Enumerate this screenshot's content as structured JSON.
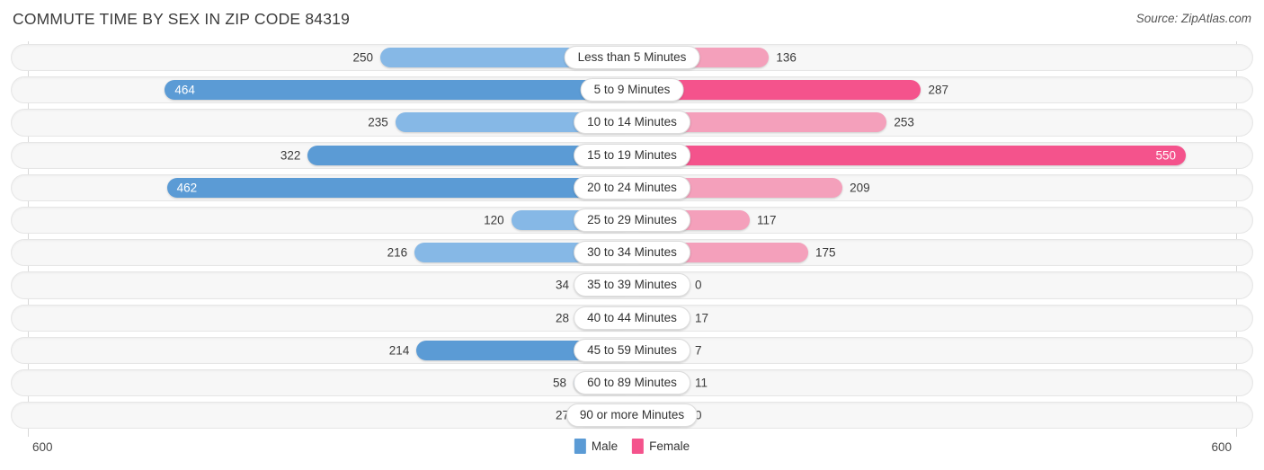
{
  "header": {
    "title": "COMMUTE TIME BY SEX IN ZIP CODE 84319",
    "source": "Source: ZipAtlas.com"
  },
  "legend": {
    "male_label": "Male",
    "female_label": "Female",
    "male_color": "#5b9bd5",
    "female_color": "#f4538c"
  },
  "axis": {
    "left_max": "600",
    "right_max": "600"
  },
  "colors": {
    "male_light": "#86b8e6",
    "male_dark": "#5b9bd5",
    "female_light": "#f4a0bb",
    "female_dark": "#f4538c",
    "track": "#f7f7f7",
    "text": "#3a3a3a"
  },
  "chart_data": {
    "type": "bar",
    "title": "COMMUTE TIME BY SEX IN ZIP CODE 84319",
    "orientation": "horizontal-diverging",
    "xlabel": "",
    "ylabel": "",
    "axis_max": 600,
    "xlim": [
      600,
      600
    ],
    "grid": false,
    "legend_position": "bottom-center",
    "categories": [
      "Less than 5 Minutes",
      "5 to 9 Minutes",
      "10 to 14 Minutes",
      "15 to 19 Minutes",
      "20 to 24 Minutes",
      "25 to 29 Minutes",
      "30 to 34 Minutes",
      "35 to 39 Minutes",
      "40 to 44 Minutes",
      "45 to 59 Minutes",
      "60 to 89 Minutes",
      "90 or more Minutes"
    ],
    "series": [
      {
        "name": "Male",
        "color": "#5b9bd5",
        "values": [
          250,
          464,
          235,
          322,
          462,
          120,
          216,
          34,
          28,
          214,
          58,
          27
        ]
      },
      {
        "name": "Female",
        "color": "#f4538c",
        "values": [
          136,
          287,
          253,
          550,
          209,
          117,
          175,
          0,
          17,
          7,
          11,
          0
        ]
      }
    ]
  },
  "rows": [
    {
      "category": "Less than 5 Minutes",
      "male": 250,
      "male_text": "250",
      "male_inside": false,
      "male_shade": "light",
      "female": 136,
      "female_text": "136",
      "female_inside": false,
      "female_shade": "light"
    },
    {
      "category": "5 to 9 Minutes",
      "male": 464,
      "male_text": "464",
      "male_inside": true,
      "male_shade": "dark",
      "female": 287,
      "female_text": "287",
      "female_inside": false,
      "female_shade": "dark"
    },
    {
      "category": "10 to 14 Minutes",
      "male": 235,
      "male_text": "235",
      "male_inside": false,
      "male_shade": "light",
      "female": 253,
      "female_text": "253",
      "female_inside": false,
      "female_shade": "light"
    },
    {
      "category": "15 to 19 Minutes",
      "male": 322,
      "male_text": "322",
      "male_inside": false,
      "male_shade": "dark",
      "female": 550,
      "female_text": "550",
      "female_inside": true,
      "female_shade": "dark"
    },
    {
      "category": "20 to 24 Minutes",
      "male": 462,
      "male_text": "462",
      "male_inside": true,
      "male_shade": "dark",
      "female": 209,
      "female_text": "209",
      "female_inside": false,
      "female_shade": "light"
    },
    {
      "category": "25 to 29 Minutes",
      "male": 120,
      "male_text": "120",
      "male_inside": false,
      "male_shade": "light",
      "female": 117,
      "female_text": "117",
      "female_inside": false,
      "female_shade": "light"
    },
    {
      "category": "30 to 34 Minutes",
      "male": 216,
      "male_text": "216",
      "male_inside": false,
      "male_shade": "light",
      "female": 175,
      "female_text": "175",
      "female_inside": false,
      "female_shade": "light"
    },
    {
      "category": "35 to 39 Minutes",
      "male": 34,
      "male_text": "34",
      "male_inside": false,
      "male_shade": "light",
      "female": 0,
      "female_text": "0",
      "female_inside": false,
      "female_shade": "light"
    },
    {
      "category": "40 to 44 Minutes",
      "male": 28,
      "male_text": "28",
      "male_inside": false,
      "male_shade": "light",
      "female": 17,
      "female_text": "17",
      "female_inside": false,
      "female_shade": "light"
    },
    {
      "category": "45 to 59 Minutes",
      "male": 214,
      "male_text": "214",
      "male_inside": false,
      "male_shade": "dark",
      "female": 7,
      "female_text": "7",
      "female_inside": false,
      "female_shade": "light"
    },
    {
      "category": "60 to 89 Minutes",
      "male": 58,
      "male_text": "58",
      "male_inside": false,
      "male_shade": "light",
      "female": 11,
      "female_text": "11",
      "female_inside": false,
      "female_shade": "light"
    },
    {
      "category": "90 or more Minutes",
      "male": 27,
      "male_text": "27",
      "male_inside": false,
      "male_shade": "light",
      "female": 0,
      "female_text": "0",
      "female_inside": false,
      "female_shade": "light"
    }
  ]
}
